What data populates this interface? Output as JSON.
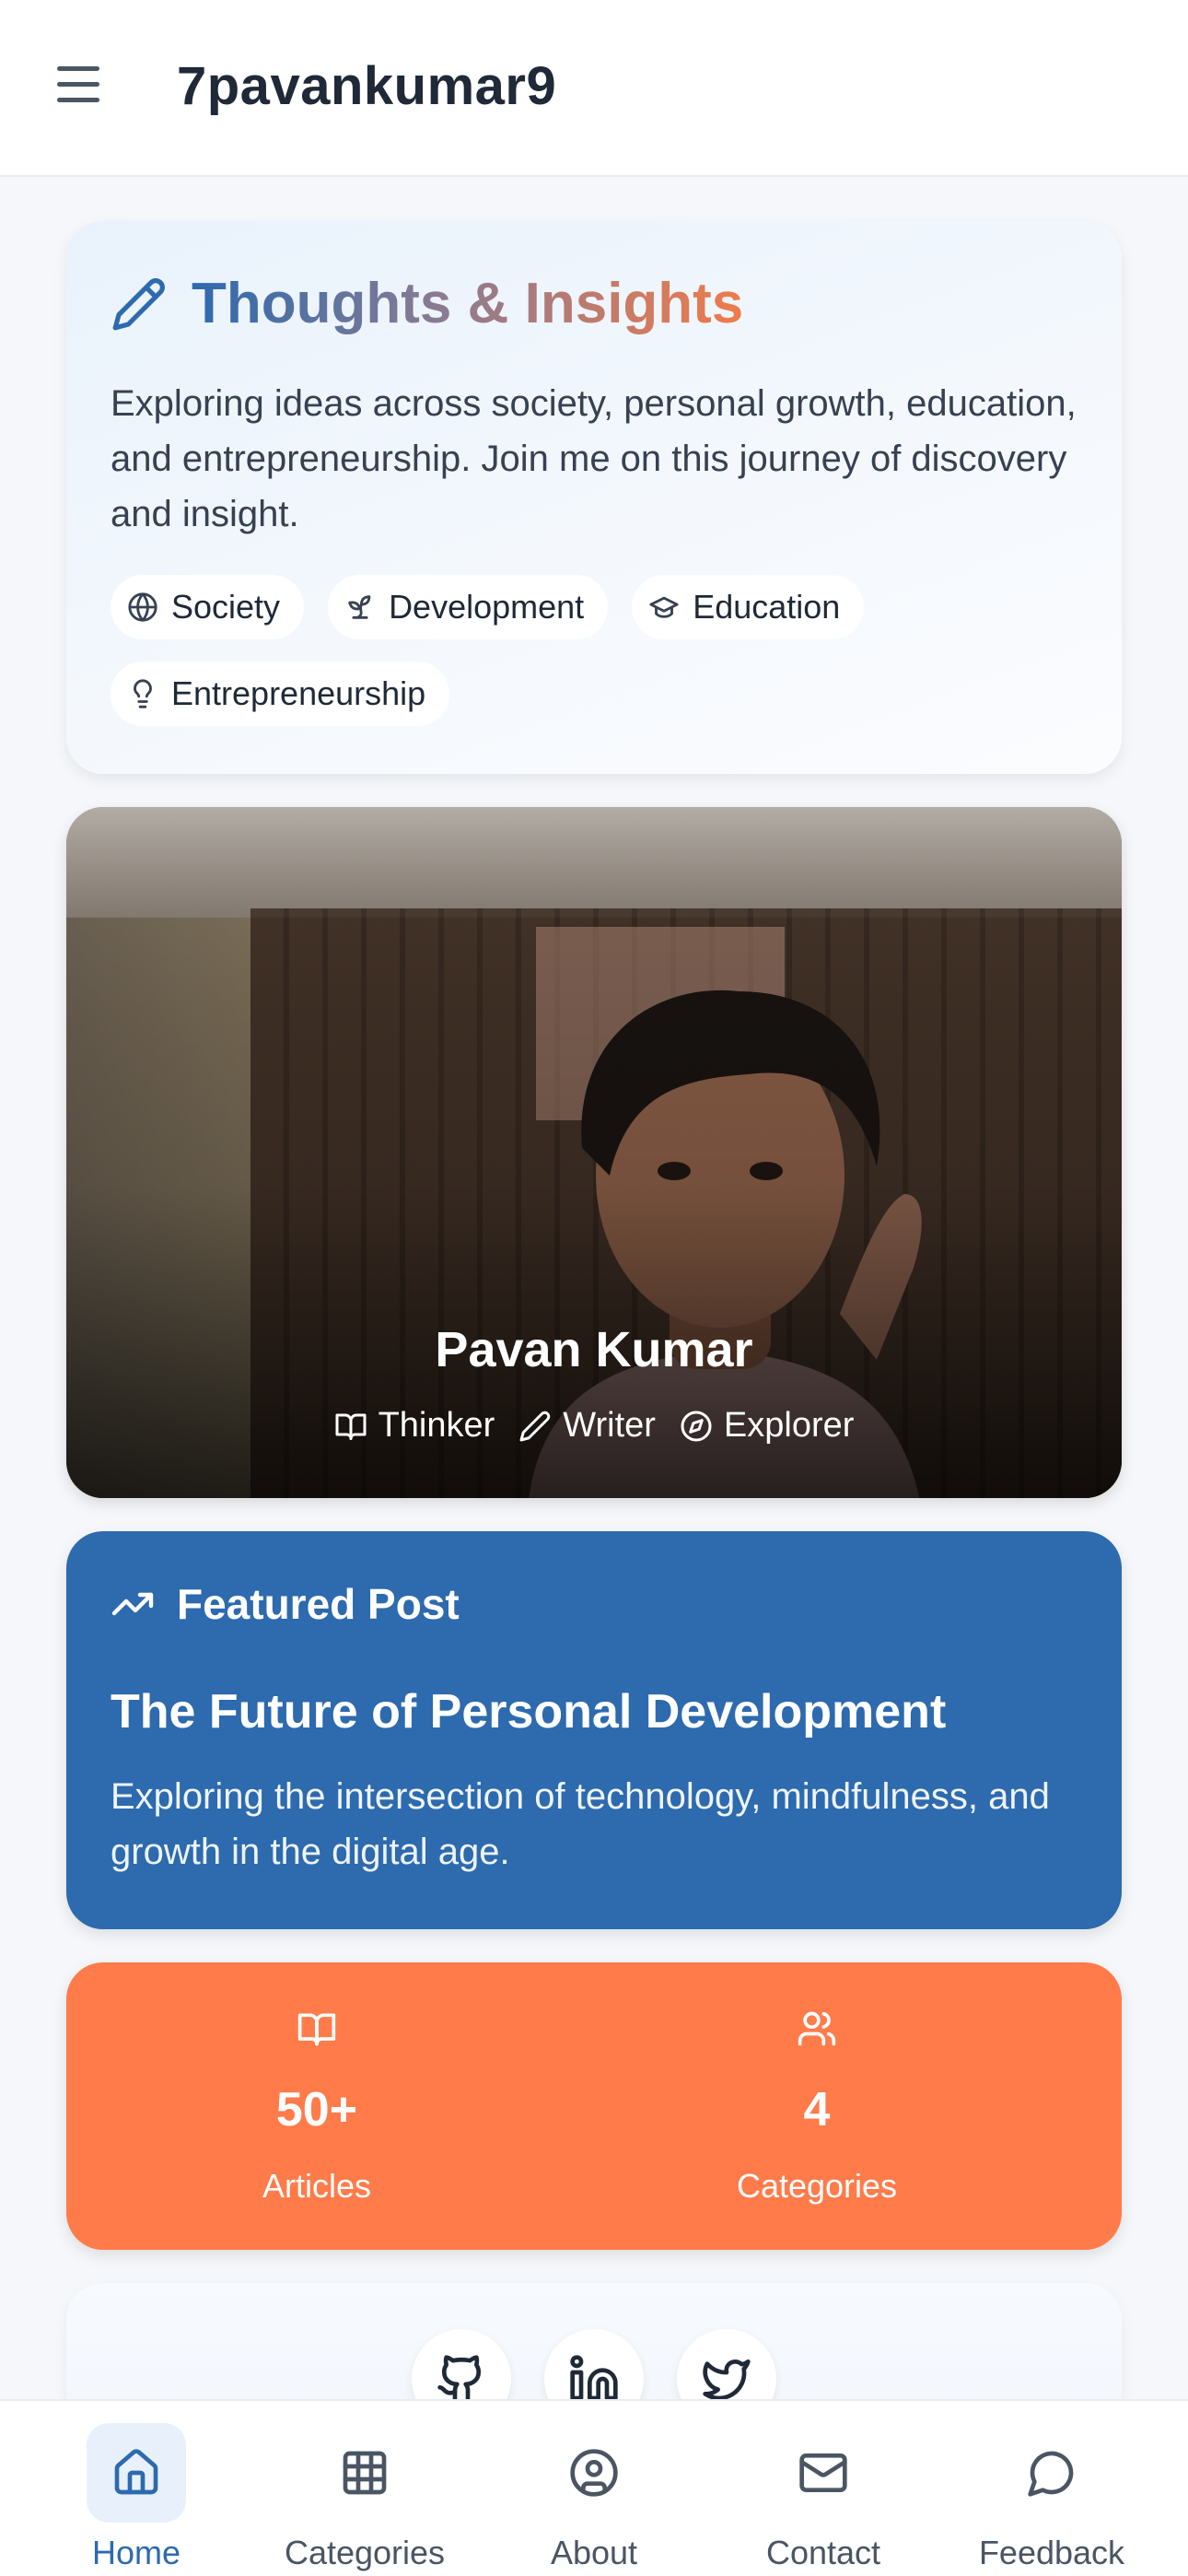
{
  "header": {
    "title": "7pavankumar9",
    "menu_icon": "menu-icon"
  },
  "intro": {
    "title_part1": "Thoughts",
    "title_amp": " & ",
    "title_part2": "Insights",
    "description": "Exploring ideas across society, personal growth, education, and entrepreneurship. Join me on this journey of discovery and insight.",
    "tags": [
      {
        "label": "Society",
        "icon": "globe-icon"
      },
      {
        "label": "Development",
        "icon": "sprout-icon"
      },
      {
        "label": "Education",
        "icon": "graduation-cap-icon"
      },
      {
        "label": "Entrepreneurship",
        "icon": "lightbulb-icon"
      }
    ]
  },
  "profile": {
    "name": "Pavan Kumar",
    "roles": [
      {
        "label": "Thinker",
        "icon": "book-open-icon"
      },
      {
        "label": "Writer",
        "icon": "pencil-icon"
      },
      {
        "label": "Explorer",
        "icon": "compass-icon"
      }
    ]
  },
  "featured": {
    "heading": "Featured Post",
    "title": "The Future of Personal Development",
    "description": "Exploring the intersection of technology, mindfulness, and growth in the digital age."
  },
  "stats": [
    {
      "value": "50+",
      "label": "Articles",
      "icon": "book-open-icon"
    },
    {
      "value": "4",
      "label": "Categories",
      "icon": "users-icon"
    }
  ],
  "social": [
    "github-icon",
    "linkedin-icon",
    "twitter-icon"
  ],
  "nav": {
    "items": [
      {
        "label": "Home",
        "icon": "home-icon",
        "active": true
      },
      {
        "label": "Categories",
        "icon": "grid-icon",
        "active": false
      },
      {
        "label": "About",
        "icon": "user-circle-icon",
        "active": false
      },
      {
        "label": "Contact",
        "icon": "mail-icon",
        "active": false
      },
      {
        "label": "Feedback",
        "icon": "message-circle-icon",
        "active": false
      }
    ]
  },
  "colors": {
    "primary_blue": "#2d6aae",
    "accent_orange": "#ff7b4a",
    "background": "#f5f7fa"
  }
}
